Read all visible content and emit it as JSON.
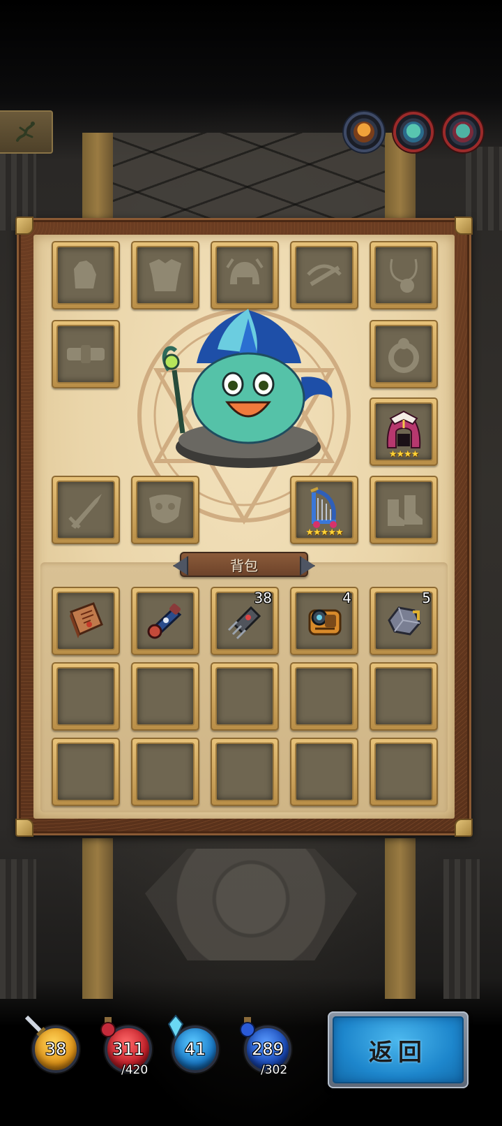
{
  "equipment": {
    "slots": [
      {
        "id": "gloves",
        "icon": "gloves-icon"
      },
      {
        "id": "chest",
        "icon": "chest-armor-icon"
      },
      {
        "id": "helmet",
        "icon": "helmet-icon"
      },
      {
        "id": "crossbow",
        "icon": "crossbow-icon"
      },
      {
        "id": "amulet",
        "icon": "amulet-icon"
      },
      {
        "id": "belt",
        "icon": "belt-icon"
      },
      {
        "id": "ring",
        "icon": "ring-icon"
      },
      {
        "id": "hood",
        "icon": "hood-icon",
        "stars": "★★★★"
      },
      {
        "id": "weapon",
        "icon": "sword-icon"
      },
      {
        "id": "mask",
        "icon": "mask-icon"
      },
      {
        "id": "harp",
        "icon": "harp-icon",
        "stars": "★★★★★"
      },
      {
        "id": "boots",
        "icon": "boots-icon"
      }
    ]
  },
  "backpack": {
    "title": "背包",
    "items": [
      {
        "icon": "book-icon",
        "count": ""
      },
      {
        "icon": "cannon-icon",
        "count": ""
      },
      {
        "icon": "chip-icon",
        "count": "38"
      },
      {
        "icon": "backpack-gear-icon",
        "count": "4"
      },
      {
        "icon": "ore-icon",
        "count": "5"
      }
    ]
  },
  "stats": {
    "attack": {
      "value": "38"
    },
    "health": {
      "value": "311",
      "max": "/420"
    },
    "defense": {
      "value": "41"
    },
    "mana": {
      "value": "289",
      "max": "/302"
    }
  },
  "return_label": "返回",
  "colors": {
    "parchment": "#ead5a9",
    "frame": "#5a321b",
    "slot_gold": "#c99a52",
    "return_blue": "#2a95d8",
    "star_yellow": "#ffd438"
  }
}
